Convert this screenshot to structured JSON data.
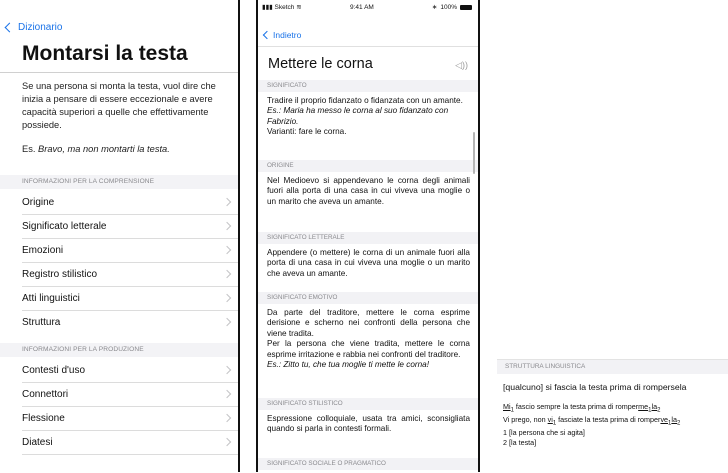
{
  "left": {
    "back_label": "Dizionario",
    "title": "Montarsi la testa",
    "description": "Se una persona si monta la testa, vuol dire che inizia a pensare di essere eccezionale e avere capacità superiori a quelle che effettivamente possiede.",
    "example_prefix": "Es.",
    "example_text": "Bravo, ma non montarti la testa.",
    "section_comprehension": "INFORMAZIONI PER LA COMPRENSIONE",
    "comprehension_items": [
      "Origine",
      "Significato letterale",
      "Emozioni",
      "Registro stilistico",
      "Atti linguistici",
      "Struttura"
    ],
    "section_production": "INFORMAZIONI PER LA PRODUZIONE",
    "production_items": [
      "Contesti d'uso",
      "Connettori",
      "Flessione",
      "Diatesi"
    ]
  },
  "middle": {
    "status": {
      "carrier": "Sketch",
      "time": "9:41 AM",
      "battery": "100%"
    },
    "back_label": "Indietro",
    "title": "Mettere le corna",
    "speaker_icon": "speaker-icon",
    "sections": {
      "significato": {
        "head": "SIGNIFICATO",
        "line1": "Tradire il proprio fidanzato o fidanzata con un amante.",
        "example": "Es.: Maria ha messo le corna al suo fidanzato con Fabrizio.",
        "variants": "Varianti: fare le corna."
      },
      "origine": {
        "head": "ORIGINE",
        "text": "Nel Medioevo si appendevano le corna degli animali fuori alla porta di una casa in cui viveva una moglie o un marito che aveva un amante."
      },
      "letterale": {
        "head": "SIGNIFICATO LETTERALE",
        "text": "Appendere (o mettere) le corna di un animale fuori alla porta di una casa in cui viveva una moglie o un marito che aveva un amante."
      },
      "emotivo": {
        "head": "SIGNIFICATO EMOTIVO",
        "text1": "Da parte del traditore, mettere le corna esprime derisione e scherno nei confronti della persona che viene tradita.",
        "text2": "Per la persona che viene tradita, mettere le corna esprime irritazione e rabbia nei confronti del traditore.",
        "example": "Es.: Zitto tu, che tua moglie ti mette le corna!"
      },
      "stilistico": {
        "head": "SIGNIFICATO STILISTICO",
        "text": "Espressione colloquiale, usata tra amici, sconsigliata quando si parla in contesti formali."
      },
      "sociale": {
        "head": "SIGNIFICATO SOCIALE O PRAGMATICO"
      }
    }
  },
  "right": {
    "head": "STRUTTURA LINGUISTICA",
    "pattern": "[qualcuno] si fascia la testa prima di rompersela",
    "example1_a": "Mi",
    "example1_sub": "1",
    "example1_b": " fascio sempre la testa prima di romper",
    "example1_c": "me",
    "example1_sub2": "1",
    "example1_d": "la",
    "example1_sub3": "2",
    "example2_a": "Vi prego, non ",
    "example2_b": "vi",
    "example2_sub": "1",
    "example2_c": " fasciate la testa prima di romper",
    "example2_d": "ve",
    "example2_sub2": "1",
    "example2_e": "la",
    "example2_sub3": "2",
    "legend1": "1 [la persona che si agita]",
    "legend2": "2 [la testa]"
  }
}
